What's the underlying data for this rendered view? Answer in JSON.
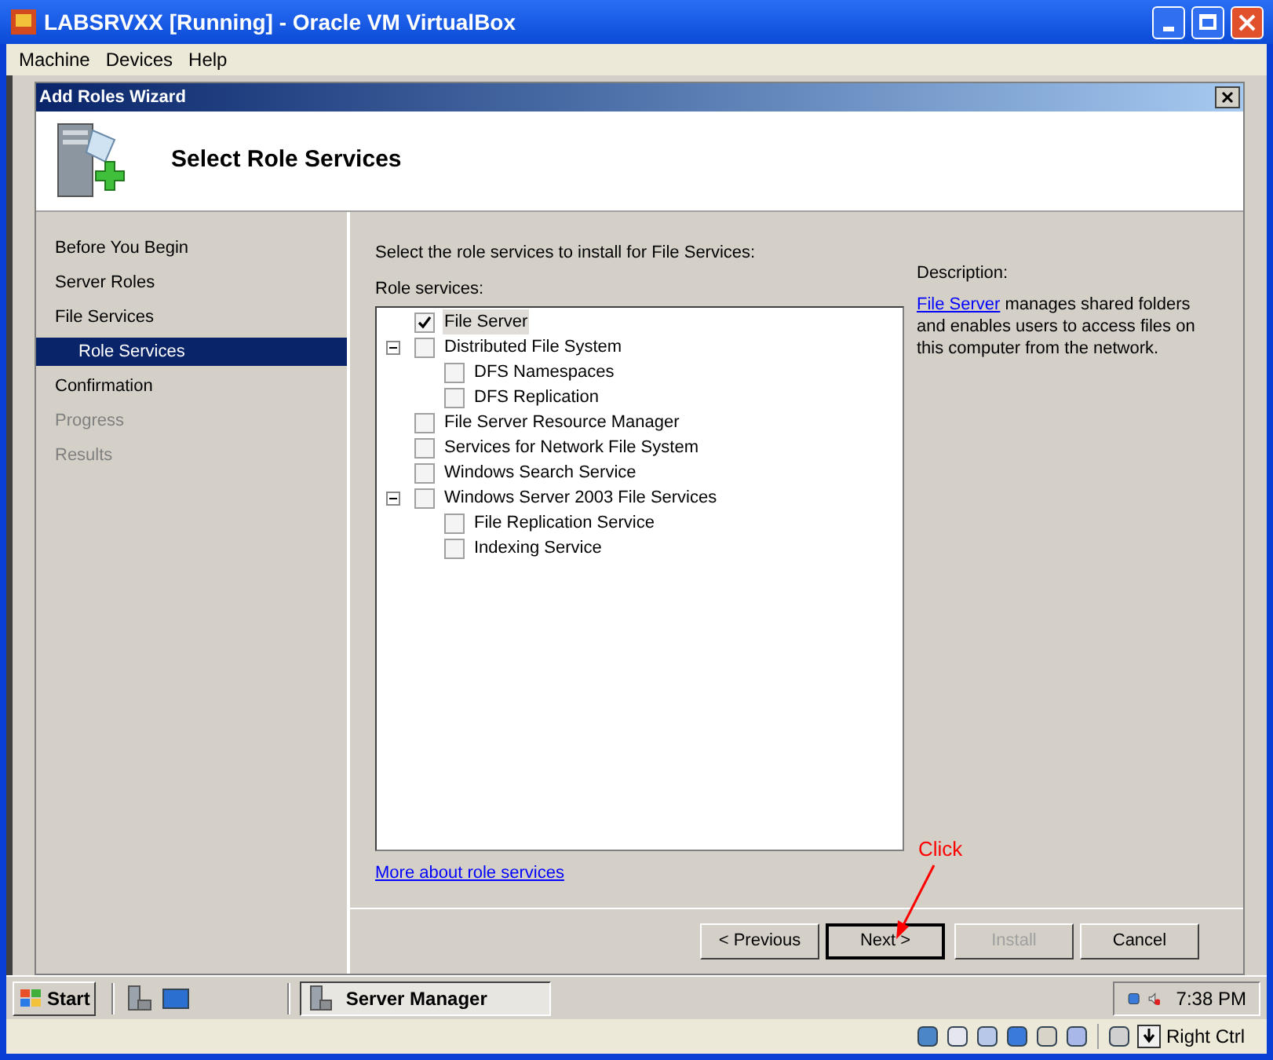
{
  "window": {
    "title": "LABSRVXX [Running] - Oracle VM VirtualBox"
  },
  "menu": [
    "Machine",
    "Devices",
    "Help"
  ],
  "wizard": {
    "title": "Add Roles Wizard",
    "heading": "Select Role Services"
  },
  "nav": [
    {
      "label": "Before You Begin",
      "selected": false,
      "disabled": false
    },
    {
      "label": "Server Roles",
      "selected": false,
      "disabled": false
    },
    {
      "label": "File Services",
      "selected": false,
      "disabled": false,
      "children": [
        {
          "label": "Role Services",
          "selected": true,
          "disabled": false
        }
      ]
    },
    {
      "label": "Confirmation",
      "selected": false,
      "disabled": false
    },
    {
      "label": "Progress",
      "selected": false,
      "disabled": true
    },
    {
      "label": "Results",
      "selected": false,
      "disabled": true
    }
  ],
  "instruction": "Select the role services to install for File Services:",
  "role_services_label": "Role services:",
  "role_services": [
    {
      "label": "File Server",
      "checked": true,
      "selected": true
    },
    {
      "label": "Distributed File System",
      "checked": false,
      "selected": false,
      "expanded": true,
      "children": [
        {
          "label": "DFS Namespaces",
          "checked": false,
          "selected": false
        },
        {
          "label": "DFS Replication",
          "checked": false,
          "selected": false
        }
      ]
    },
    {
      "label": "File Server Resource Manager",
      "checked": false,
      "selected": false
    },
    {
      "label": "Services for Network File System",
      "checked": false,
      "selected": false
    },
    {
      "label": "Windows Search Service",
      "checked": false,
      "selected": false
    },
    {
      "label": "Windows Server 2003 File Services",
      "checked": false,
      "selected": false,
      "expanded": true,
      "children": [
        {
          "label": "File Replication Service",
          "checked": false,
          "selected": false
        },
        {
          "label": "Indexing Service",
          "checked": false,
          "selected": false
        }
      ]
    }
  ],
  "description": {
    "heading": "Description:",
    "link": "File Server",
    "text": " manages shared folders and enables users to access files on this computer from the network."
  },
  "more_link": "More about role services",
  "buttons": [
    {
      "label": "< Previous",
      "disabled": false,
      "default": false
    },
    {
      "label": "Next >",
      "disabled": false,
      "default": true
    },
    {
      "label": "Install",
      "disabled": true,
      "default": false
    },
    {
      "label": "Cancel",
      "disabled": false,
      "default": false
    }
  ],
  "annotation": "Click",
  "taskbar": {
    "start": "Start",
    "task": "Server Manager",
    "clock": "7:38 PM"
  },
  "status_bar": {
    "host_key": "Right Ctrl"
  }
}
